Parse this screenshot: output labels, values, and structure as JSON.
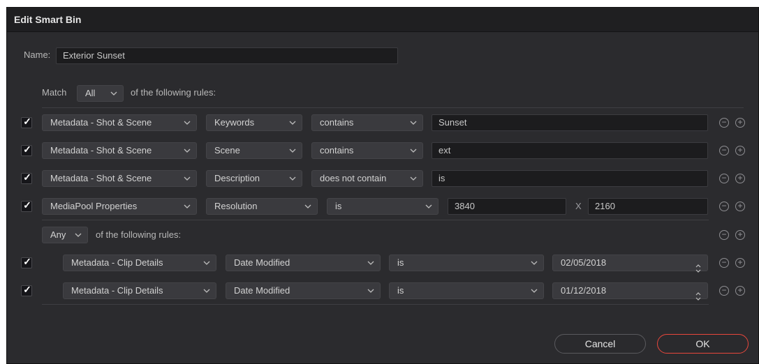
{
  "dialog": {
    "title": "Edit Smart Bin"
  },
  "name": {
    "label": "Name:",
    "value": "Exterior Sunset"
  },
  "match": {
    "label": "Match",
    "value": "All",
    "suffix": "of the following rules:"
  },
  "rules": [
    {
      "checked": true,
      "category": "Metadata - Shot & Scene",
      "field": "Keywords",
      "operator": "contains",
      "value": "Sunset"
    },
    {
      "checked": true,
      "category": "Metadata - Shot & Scene",
      "field": "Scene",
      "operator": "contains",
      "value": "ext"
    },
    {
      "checked": true,
      "category": "Metadata - Shot & Scene",
      "field": "Description",
      "operator": "does not contain",
      "value": "is"
    },
    {
      "checked": true,
      "category": "MediaPool Properties",
      "field": "Resolution",
      "operator": "is",
      "value": "3840",
      "x_label": "X",
      "value2": "2160"
    }
  ],
  "subgroup": {
    "match_value": "Any",
    "suffix": "of the following rules:",
    "rules": [
      {
        "checked": true,
        "category": "Metadata - Clip Details",
        "field": "Date Modified",
        "operator": "is",
        "value": "02/05/2018"
      },
      {
        "checked": true,
        "category": "Metadata - Clip Details",
        "field": "Date Modified",
        "operator": "is",
        "value": "01/12/2018"
      }
    ]
  },
  "buttons": {
    "cancel": "Cancel",
    "ok": "OK"
  },
  "icons": {
    "check": "✓",
    "remove": "−",
    "add": "+"
  },
  "colors": {
    "ok_border": "#e8473c",
    "dialog_bg": "#2b2b2e"
  }
}
